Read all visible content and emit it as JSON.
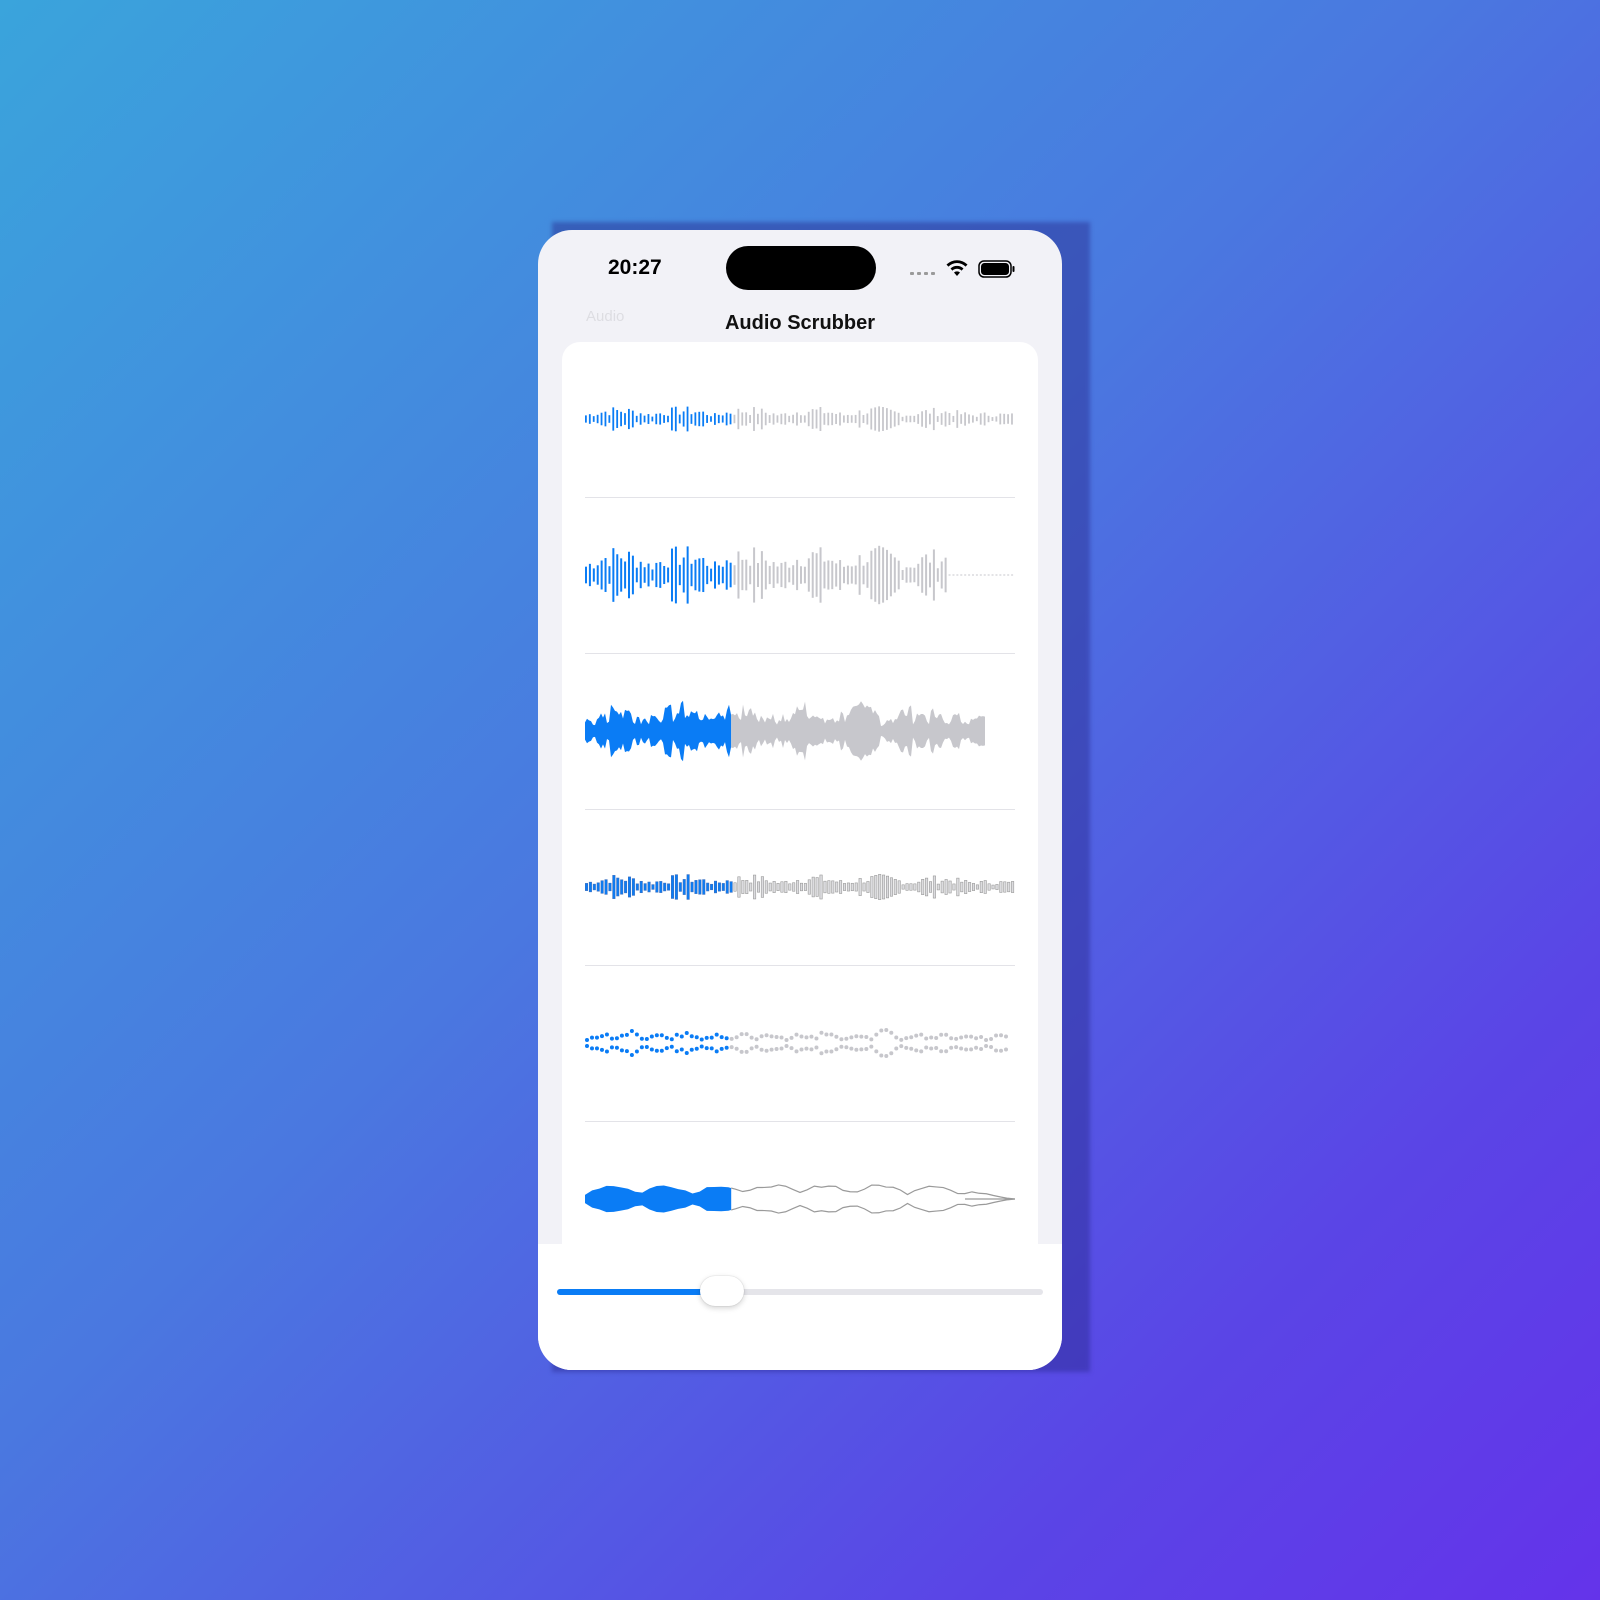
{
  "status_bar": {
    "time": "20:27"
  },
  "nav": {
    "back_label": "Audio",
    "title": "Audio Scrubber"
  },
  "colors": {
    "played": "#0a7cf5",
    "unplayed": "#c7c7cc",
    "outline": "#9a9a9a"
  },
  "scrubber": {
    "progress": 0.34
  },
  "waveform_rows": [
    {
      "style": "thin-bars"
    },
    {
      "style": "tall-bars"
    },
    {
      "style": "filled-wave"
    },
    {
      "style": "bordered-bars"
    },
    {
      "style": "dots"
    },
    {
      "style": "smooth-outline"
    }
  ]
}
